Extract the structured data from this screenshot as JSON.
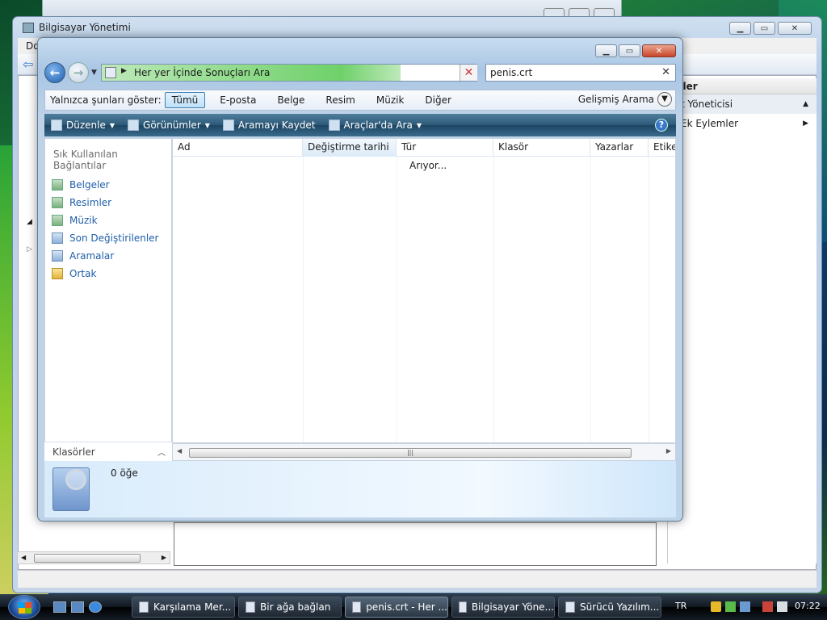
{
  "background_window": {
    "title": "Bilgisayar Yönetimi",
    "menu_first": "Do",
    "actions_header": "mler",
    "actions": [
      {
        "label": "t Yöneticisi",
        "arrow": "▲"
      },
      {
        "label": "Ek Eylemler",
        "arrow": "▶"
      }
    ]
  },
  "search_window": {
    "address_text": "Her yer İçinde Sonuçları Ara",
    "search_query": "penis.crt",
    "filter_label": "Yalnızca şunları göster:",
    "filters": [
      "Tümü",
      "E-posta",
      "Belge",
      "Resim",
      "Müzik",
      "Diğer"
    ],
    "active_filter": "Tümü",
    "advanced_search": "Gelişmiş Arama",
    "commands": {
      "organize": "Düzenle",
      "views": "Görünümler",
      "save_search": "Aramayı Kaydet",
      "search_tools": "Araçlar'da Ara"
    },
    "nav_header": "Sık Kullanılan Bağlantılar",
    "nav_items": [
      "Belgeler",
      "Resimler",
      "Müzik",
      "Son Değiştirilenler",
      "Aramalar",
      "Ortak"
    ],
    "folders_label": "Klasörler",
    "columns": [
      "Ad",
      "Değiştirme tarihi",
      "Tür",
      "Klasör",
      "Yazarlar",
      "Etiket"
    ],
    "status_text": "Arıyor...",
    "item_count": "0 öğe"
  },
  "taskbar": {
    "buttons": [
      {
        "label": "Karşılama Mer..."
      },
      {
        "label": "Bir ağa bağlan"
      },
      {
        "label": "penis.crt - Her ..."
      },
      {
        "label": "Bilgisayar Yöne..."
      },
      {
        "label": "Sürücü Yazılım..."
      }
    ],
    "active_index": 2,
    "language": "TR",
    "time": "07:22"
  }
}
